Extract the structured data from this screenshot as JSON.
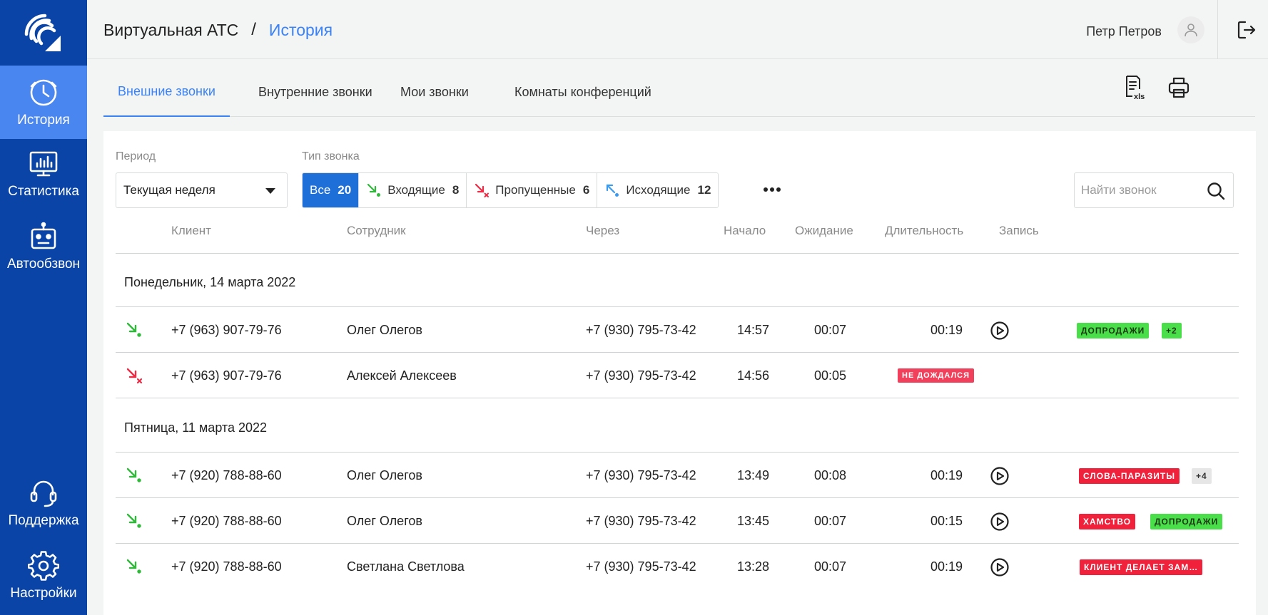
{
  "sidebar": {
    "items": [
      {
        "label": "История",
        "icon": "clock-icon",
        "active": true
      },
      {
        "label": "Статистика",
        "icon": "chart-monitor-icon"
      },
      {
        "label": "Автообзвон",
        "icon": "robot-icon"
      },
      {
        "label": "Поддержка",
        "icon": "headset-icon"
      },
      {
        "label": "Настройки",
        "icon": "gear-icon"
      }
    ]
  },
  "header": {
    "root": "Виртуальная АТС",
    "separator": "/",
    "current": "История",
    "user_name": "Петр Петров"
  },
  "tabs": [
    {
      "label": "Внешние звонки",
      "active": true
    },
    {
      "label": "Внутренние звонки"
    },
    {
      "label": "Мои звонки"
    },
    {
      "label": "Комнаты конференций"
    }
  ],
  "filters": {
    "period_label": "Период",
    "period_value": "Текущая неделя",
    "type_label": "Тип звонка",
    "types": [
      {
        "label": "Все",
        "count": "20",
        "active": true
      },
      {
        "label": "Входящие",
        "count": "8",
        "icon": "incoming-icon"
      },
      {
        "label": "Пропущенные",
        "count": "6",
        "icon": "missed-icon"
      },
      {
        "label": "Исходящие",
        "count": "12",
        "icon": "outgoing-icon"
      }
    ],
    "more": "•••",
    "search_placeholder": "Найти звонок"
  },
  "columns": {
    "client": "Клиент",
    "employee": "Сотрудник",
    "via": "Через",
    "start": "Начало",
    "wait": "Ожидание",
    "duration": "Длительность",
    "record": "Запись"
  },
  "groups": [
    {
      "date": "Понедельник, 14 марта 2022",
      "rows": [
        {
          "direction": "incoming",
          "client": "+7 (963) 907-79-76",
          "employee": "Олег Олегов",
          "via": "+7 (930) 795-73-42",
          "start": "14:57",
          "wait": "00:07",
          "duration": "00:19",
          "record": true,
          "tags": [
            {
              "text": "ДОПРОДАЖИ",
              "color": "green"
            },
            {
              "text": "+2",
              "color": "green"
            }
          ]
        },
        {
          "direction": "missed",
          "client": "+7 (963) 907-79-76",
          "employee": "Алексей Алексеев",
          "via": "+7 (930) 795-73-42",
          "start": "14:56",
          "wait": "00:05",
          "duration_tag": "НЕ ДОЖДАЛСЯ",
          "record": false,
          "tags": []
        }
      ]
    },
    {
      "date": "Пятница, 11 марта 2022",
      "rows": [
        {
          "direction": "incoming",
          "client": "+7 (920) 788-88-60",
          "employee": "Олег Олегов",
          "via": "+7 (930) 795-73-42",
          "start": "13:49",
          "wait": "00:08",
          "duration": "00:19",
          "record": true,
          "tags": [
            {
              "text": "СЛОВА-ПАРАЗИТЫ",
              "color": "red"
            },
            {
              "text": "+4",
              "color": "gray"
            }
          ]
        },
        {
          "direction": "incoming",
          "client": "+7 (920) 788-88-60",
          "employee": "Олег Олегов",
          "via": "+7 (930) 795-73-42",
          "start": "13:45",
          "wait": "00:07",
          "duration": "00:15",
          "record": true,
          "tags": [
            {
              "text": "ХАМСТВО",
              "color": "red"
            },
            {
              "text": "ДОПРОДАЖИ",
              "color": "green"
            }
          ]
        },
        {
          "direction": "incoming",
          "client": "+7 (920) 788-88-60",
          "employee": "Светлана Светлова",
          "via": "+7 (930) 795-73-42",
          "start": "13:28",
          "wait": "00:07",
          "duration": "00:19",
          "record": true,
          "tags": [
            {
              "text": "КЛИЕНТ ДЕЛАЕТ ЗАМ…",
              "color": "red"
            }
          ]
        }
      ]
    }
  ],
  "colors": {
    "sidebar": "#0944a6",
    "sidebar_active": "#4a86f0",
    "accent": "#3b82f6",
    "segment_active": "#1f6fd8",
    "incoming": "#2fb83a",
    "missed": "#ef2b45",
    "outgoing": "#3b9af0"
  }
}
